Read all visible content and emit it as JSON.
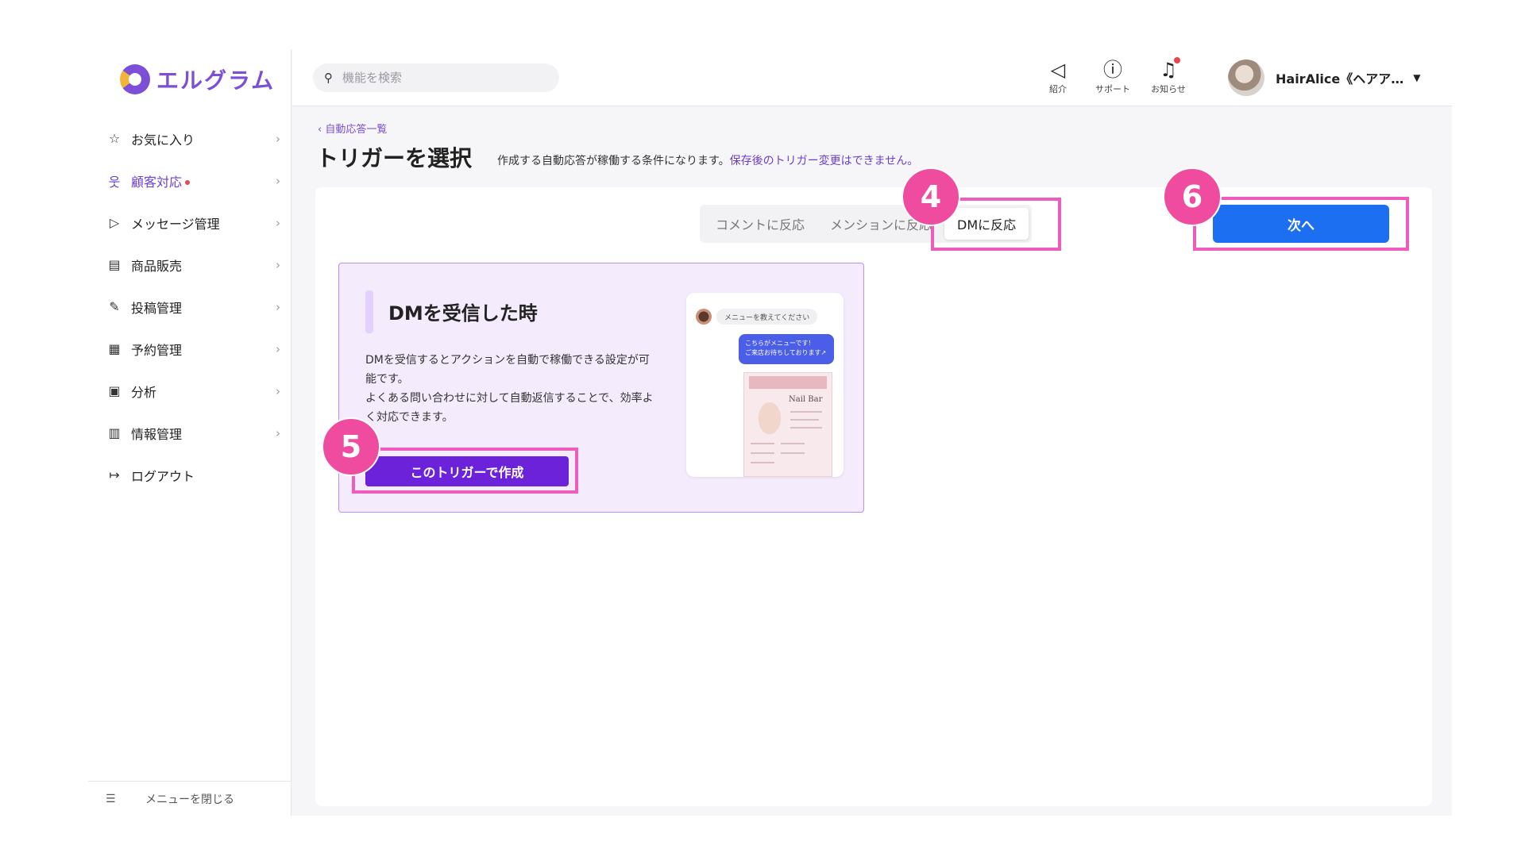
{
  "sidebar": {
    "logo_text": "エルグラム",
    "items": [
      {
        "label": "お気に入り",
        "icon": "star-icon",
        "glyph": "☆"
      },
      {
        "label": "顧客対応",
        "icon": "user-icon",
        "glyph": "웃"
      },
      {
        "label": "メッセージ管理",
        "icon": "send-icon",
        "glyph": "▷"
      },
      {
        "label": "商品販売",
        "icon": "store-icon",
        "glyph": "▤"
      },
      {
        "label": "投稿管理",
        "icon": "edit-icon",
        "glyph": "✎"
      },
      {
        "label": "予約管理",
        "icon": "calendar-icon",
        "glyph": "▦"
      },
      {
        "label": "分析",
        "icon": "report-icon",
        "glyph": "▣"
      },
      {
        "label": "情報管理",
        "icon": "chart-icon",
        "glyph": "▥"
      },
      {
        "label": "ログアウト",
        "icon": "logout-icon",
        "glyph": "↦"
      }
    ],
    "collapse_label": "メニューを閉じる"
  },
  "topbar": {
    "search_placeholder": "機能を検索",
    "tools": [
      {
        "label": "紹介",
        "icon": "megaphone-icon"
      },
      {
        "label": "サポート",
        "icon": "help-icon"
      },
      {
        "label": "お知らせ",
        "icon": "bell-icon"
      }
    ],
    "user_name": "HairAlice《ヘアア…"
  },
  "page": {
    "breadcrumb": "自動応答一覧",
    "title": "トリガーを選択",
    "subtitle": "作成する自動応答が稼働する条件になります。",
    "subtitle_warning": "保存後のトリガー変更はできません。"
  },
  "tabs": [
    {
      "label": "コメントに反応",
      "active": false
    },
    {
      "label": "メンションに反応",
      "active": false
    },
    {
      "label": "DMに反応",
      "active": true
    }
  ],
  "next_button": "次へ",
  "card": {
    "title": "DMを受信した時",
    "description": "DMを受信するとアクションを自動で稼働できる設定が可\n能です。\nよくある問い合わせに対して自動返信することで、効率よ\nく対応できます。",
    "button": "このトリガーで作成",
    "preview": {
      "incoming": "メニューを教えてください",
      "outgoing": "こちらがメニューです！\nご来店お待ちしております↗",
      "brand": "Nail Bar"
    }
  },
  "annotations": [
    "4",
    "5",
    "6"
  ],
  "colors": {
    "brand_purple": "#7b4fd6",
    "primary_blue": "#1b6ff0",
    "create_purple": "#6b22d8",
    "annotation_pink": "#f04c9f"
  }
}
